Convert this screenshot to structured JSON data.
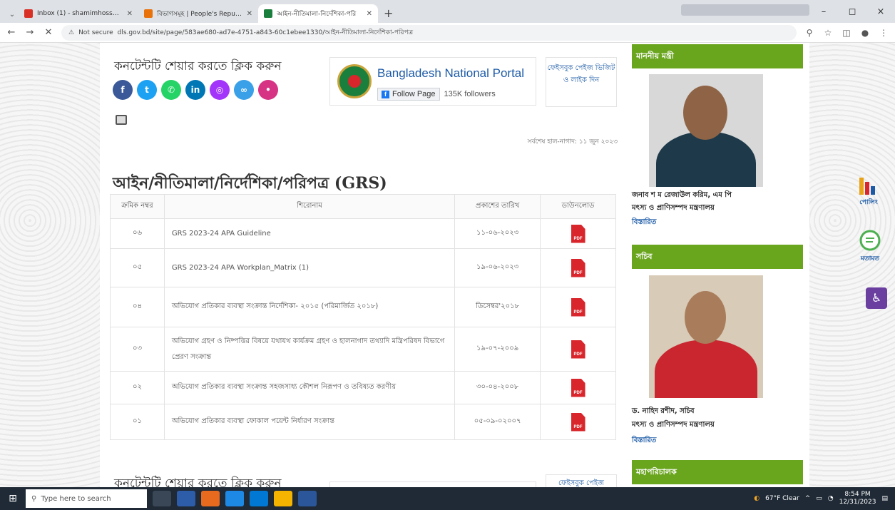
{
  "browser": {
    "tabs": [
      {
        "title": "Inbox (1) - shamimhossainfm",
        "favicon_color": "#d93025",
        "active": false
      },
      {
        "title": "বিভাগসমূহ | People's Republic",
        "favicon_color": "#e8710a",
        "active": false
      },
      {
        "title": "আইন-নীতিমালা-নির্দেশিকা-পরি",
        "favicon_color": "#1a7f3c",
        "active": true
      }
    ],
    "new_tab": "+",
    "security_label": "Not secure",
    "url": "dls.gov.bd/site/page/583ae680-ad7e-4751-a843-60c1ebee1330/আইন-নীতিমালা-নির্দেশিকা-পরিপত্র",
    "win_controls": [
      "–",
      "◻",
      "×"
    ]
  },
  "main": {
    "share_title": "কনটেন্টটি শেয়ার করতে ক্লিক করুন",
    "social_icons": [
      {
        "name": "facebook-icon",
        "glyph": "f",
        "color": "#3b5998"
      },
      {
        "name": "twitter-icon",
        "glyph": "t",
        "color": "#1da1f2"
      },
      {
        "name": "whatsapp-icon",
        "glyph": "w",
        "color": "#25d366"
      },
      {
        "name": "linkedin-icon",
        "glyph": "in",
        "color": "#0077b5"
      },
      {
        "name": "messenger-icon",
        "glyph": "m",
        "color": "#a334fa"
      },
      {
        "name": "link-icon",
        "glyph": "∞",
        "color": "#3aa0e8"
      },
      {
        "name": "more-icon",
        "glyph": "•",
        "color": "#d63384"
      }
    ],
    "bnp": {
      "title": "Bangladesh National Portal",
      "follow_label": "Follow Page",
      "followers": "135K followers"
    },
    "fb_visit": "ফেইসবুক পেইজ ভিজিট ও লাইক দিন",
    "last_update": "সর্বশেষ হাল-নাগাদ: ১১ জুন ২০২৩",
    "page_title": "আইন/নীতিমালা/নির্দেশিকা/পরিপত্র (GRS)",
    "table": {
      "headers": [
        "ক্রমিক নম্বর",
        "শিরোনাম",
        "প্রকাশের তারিখ",
        "ডাউনলোড"
      ],
      "rows": [
        {
          "serial": "০৬",
          "title": "GRS 2023-24 APA Guideline",
          "date": "১১-০৬-২০২৩",
          "file": "PDF"
        },
        {
          "serial": "০৫",
          "title": "GRS 2023-24 APA Workplan_Matrix (1)",
          "date": "১৯-০৬-২০২৩",
          "file": "PDF"
        },
        {
          "serial": "০৪",
          "title": "অভিযোগ প্রতিকার ব্যবস্থা সংক্রান্ত নির্দেশিকা- ২০১৫ (পরিমার্জিত ২০১৮)",
          "date": "ডিসেম্বর'২০১৮",
          "file": "PDF"
        },
        {
          "serial": "০৩",
          "title": "অভিযোগ গ্রহণ ও নিষ্পত্তির বিষয়ে যথাযথ কার্যক্রম গ্রহণ ও হালনাগাদ তথ্যাদি মন্ত্রিপরিষদ বিভাগে প্রেরণ সংক্রান্ত",
          "date": "১৯-০৭-২০০৯",
          "file": "PDF"
        },
        {
          "serial": "০২",
          "title": "অভিযোগ প্রতিকার ব্যবস্থা সংক্রান্ত সহজসাধ্য কৌশল নিরূপণ ও তবিষ্যত করণীয়",
          "date": "৩০-০৪-২০০৮",
          "file": "PDF"
        },
        {
          "serial": "০১",
          "title": "অভিযোগ প্রতিকার ব্যবস্থা ফোকাল পয়েন্ট নির্ধারণ সংক্রান্ত",
          "date": "০৫-০৯-০২০০৭",
          "file": "PDF"
        }
      ]
    },
    "bottom_share": "কনটেন্টটি শেয়ার করতে ক্লিক করুন",
    "bottom_fb": "ফেইসবুক পেইজ"
  },
  "sidebar": {
    "minister": {
      "heading": "মাননীয় মন্ত্রী",
      "name": "জনাব শ ম রেজাউল করিম, এম পি",
      "ministry": "মৎস্য ও প্রাণিসম্পদ মন্ত্রণালয়",
      "more": "বিস্তারিত"
    },
    "secretary": {
      "heading": "সচিব",
      "name": "ড. নাহিদ রশীদ, সচিব",
      "ministry": "মৎস্য ও প্রাণিসম্পদ মন্ত্রণালয়",
      "more": "বিস্তারিত"
    },
    "dg": {
      "heading": "মহাপরিচালক"
    }
  },
  "right_widgets": {
    "poll": "পোলিং",
    "feedback": "মতামত"
  },
  "taskbar": {
    "search_placeholder": "Type here to search",
    "weather": "67°F Clear",
    "time": "8:54 PM",
    "date": "12/31/2023"
  }
}
